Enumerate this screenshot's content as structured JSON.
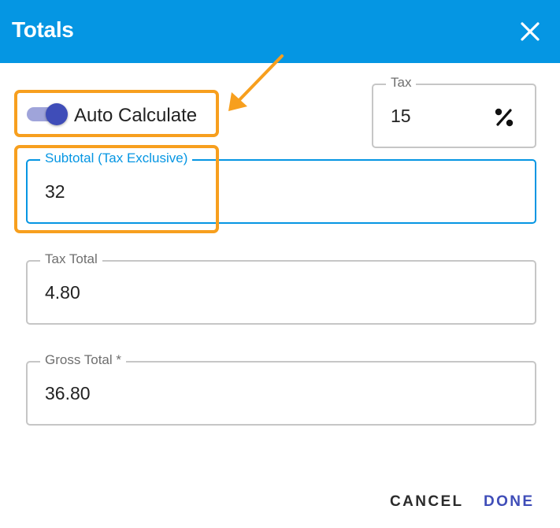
{
  "dialog": {
    "title": "Totals",
    "close_icon": "close-icon"
  },
  "auto_calculate": {
    "label": "Auto Calculate",
    "enabled": true
  },
  "tax": {
    "label": "Tax",
    "value": "15",
    "icon": "percent-icon"
  },
  "subtotal": {
    "label": "Subtotal (Tax Exclusive)",
    "value": "32"
  },
  "tax_total": {
    "label": "Tax Total",
    "value": "4.80"
  },
  "gross_total": {
    "label": "Gross Total *",
    "value": "36.80"
  },
  "actions": {
    "cancel_label": "CANCEL",
    "done_label": "DONE"
  },
  "colors": {
    "header": "#0596e3",
    "accent": "#3f4db8",
    "highlight": "#f79f1e"
  }
}
